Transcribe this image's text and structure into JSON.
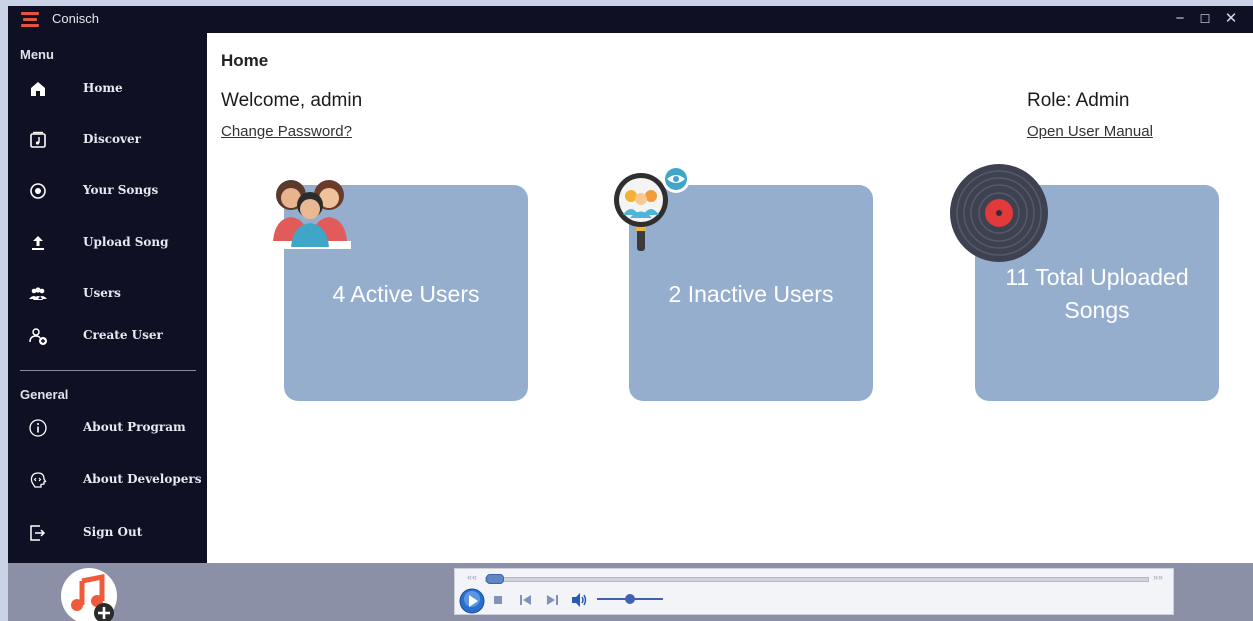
{
  "window": {
    "title": "Conisch",
    "minimize": "−",
    "maximize": "☐",
    "close": "✕"
  },
  "sidebar": {
    "menu_label": "Menu",
    "menu_items": [
      {
        "label": "Home",
        "icon": "home-icon"
      },
      {
        "label": "Discover",
        "icon": "music-note-icon"
      },
      {
        "label": "Your Songs",
        "icon": "disc-icon"
      },
      {
        "label": "Upload Song",
        "icon": "upload-icon"
      },
      {
        "label": "Users",
        "icon": "users-icon"
      },
      {
        "label": "Create User",
        "icon": "add-user-icon"
      }
    ],
    "general_label": "General",
    "general_items": [
      {
        "label": "About Program",
        "icon": "info-icon"
      },
      {
        "label": "About Developers",
        "icon": "developer-icon"
      },
      {
        "label": "Sign Out",
        "icon": "sign-out-icon"
      }
    ]
  },
  "main": {
    "page_title": "Home",
    "welcome": "Welcome, admin",
    "change_password": "Change Password?",
    "role": "Role: Admin",
    "user_manual": "Open User Manual",
    "cards": [
      {
        "text": "4 Active Users",
        "icon": "active-users-icon"
      },
      {
        "text": "2 Inactive Users",
        "icon": "inactive-users-icon"
      },
      {
        "line1": "11 Total Uploaded",
        "line2": "Songs",
        "icon": "vinyl-record-icon"
      }
    ]
  },
  "player": {
    "rewind": "««",
    "fast_forward": "»»",
    "seek_level": 0.01,
    "volume_level": 0.5
  },
  "colors": {
    "sidebar_bg": "#0f1024",
    "card_bg": "#96aece",
    "bottom_bar_bg": "#8c90a6",
    "accent": "#3f63b0"
  }
}
